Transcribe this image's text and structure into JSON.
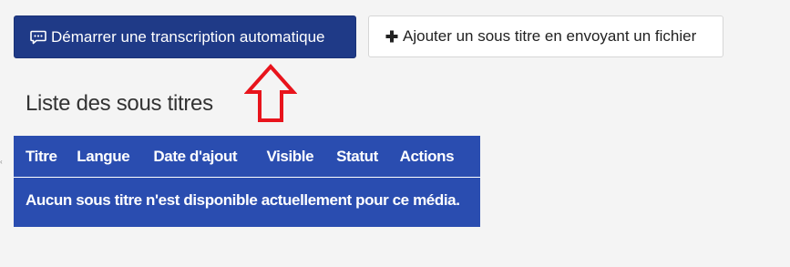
{
  "toolbar": {
    "auto_transcription_label": "Démarrer une transcription automatique",
    "upload_subtitle_label": "Ajouter un sous titre en envoyant un fichier",
    "auto_transcription_icon": "comment-dots-icon",
    "upload_subtitle_icon": "plus-icon"
  },
  "annotation": {
    "arrow_icon": "up-arrow-icon",
    "arrow_color": "#e8141c"
  },
  "subtitles": {
    "title": "Liste des sous titres",
    "columns": [
      "Titre",
      "Langue",
      "Date d'ajout",
      "Visible",
      "Statut",
      "Actions"
    ],
    "empty_message": "Aucun sous titre n'est disponible actuellement pour ce média."
  },
  "colors": {
    "primary_button": "#1f3a87",
    "table_background": "#2a4db0",
    "page_background": "#f4f4f4"
  }
}
